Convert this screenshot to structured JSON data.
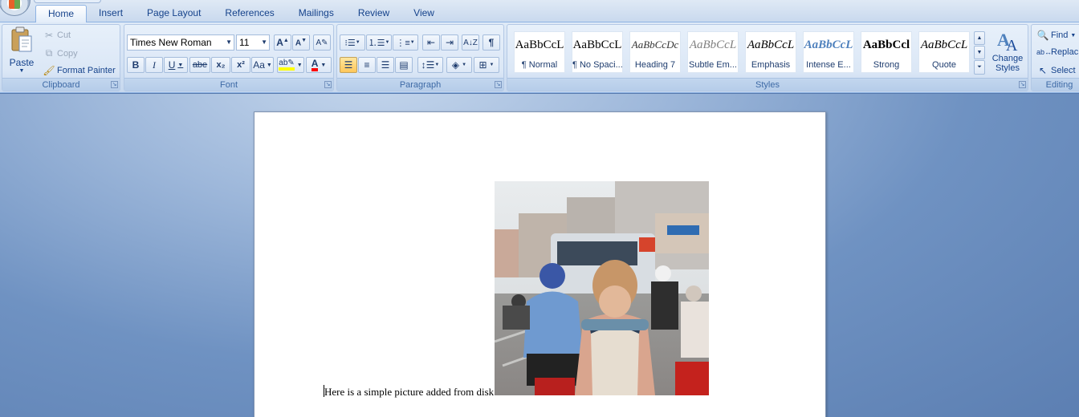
{
  "tabs": [
    {
      "label": "Home",
      "active": true
    },
    {
      "label": "Insert"
    },
    {
      "label": "Page Layout"
    },
    {
      "label": "References"
    },
    {
      "label": "Mailings"
    },
    {
      "label": "Review"
    },
    {
      "label": "View"
    }
  ],
  "clipboard": {
    "group_label": "Clipboard",
    "paste": "Paste",
    "cut": "Cut",
    "copy": "Copy",
    "format_painter": "Format Painter"
  },
  "font": {
    "group_label": "Font",
    "family": "Times New Roman",
    "size": "11",
    "bold": "B",
    "italic": "I",
    "underline": "U",
    "strike": "abe",
    "subscript": "x₂",
    "superscript": "x²",
    "change_case": "Aa",
    "highlight_color": "#ffff00",
    "font_color": "#ff0000"
  },
  "paragraph": {
    "group_label": "Paragraph"
  },
  "styles": {
    "group_label": "Styles",
    "items": [
      {
        "sample": "AaBbCcL",
        "name": "¶ Normal"
      },
      {
        "sample": "AaBbCcL",
        "name": "¶ No Spaci..."
      },
      {
        "sample": "AaBbCcDc",
        "name": "Heading 7"
      },
      {
        "sample": "AaBbCcL",
        "name": "Subtle Em..."
      },
      {
        "sample": "AaBbCcL",
        "name": "Emphasis"
      },
      {
        "sample": "AaBbCcL",
        "name": "Intense E..."
      },
      {
        "sample": "AaBbCcl",
        "name": "Strong"
      },
      {
        "sample": "AaBbCcL",
        "name": "Quote"
      }
    ],
    "change_styles": "Change Styles"
  },
  "editing": {
    "group_label": "Editing",
    "find": "Find",
    "replace": "Replac",
    "select": "Select"
  },
  "document": {
    "text": "Here is a simple picture added from disk"
  }
}
